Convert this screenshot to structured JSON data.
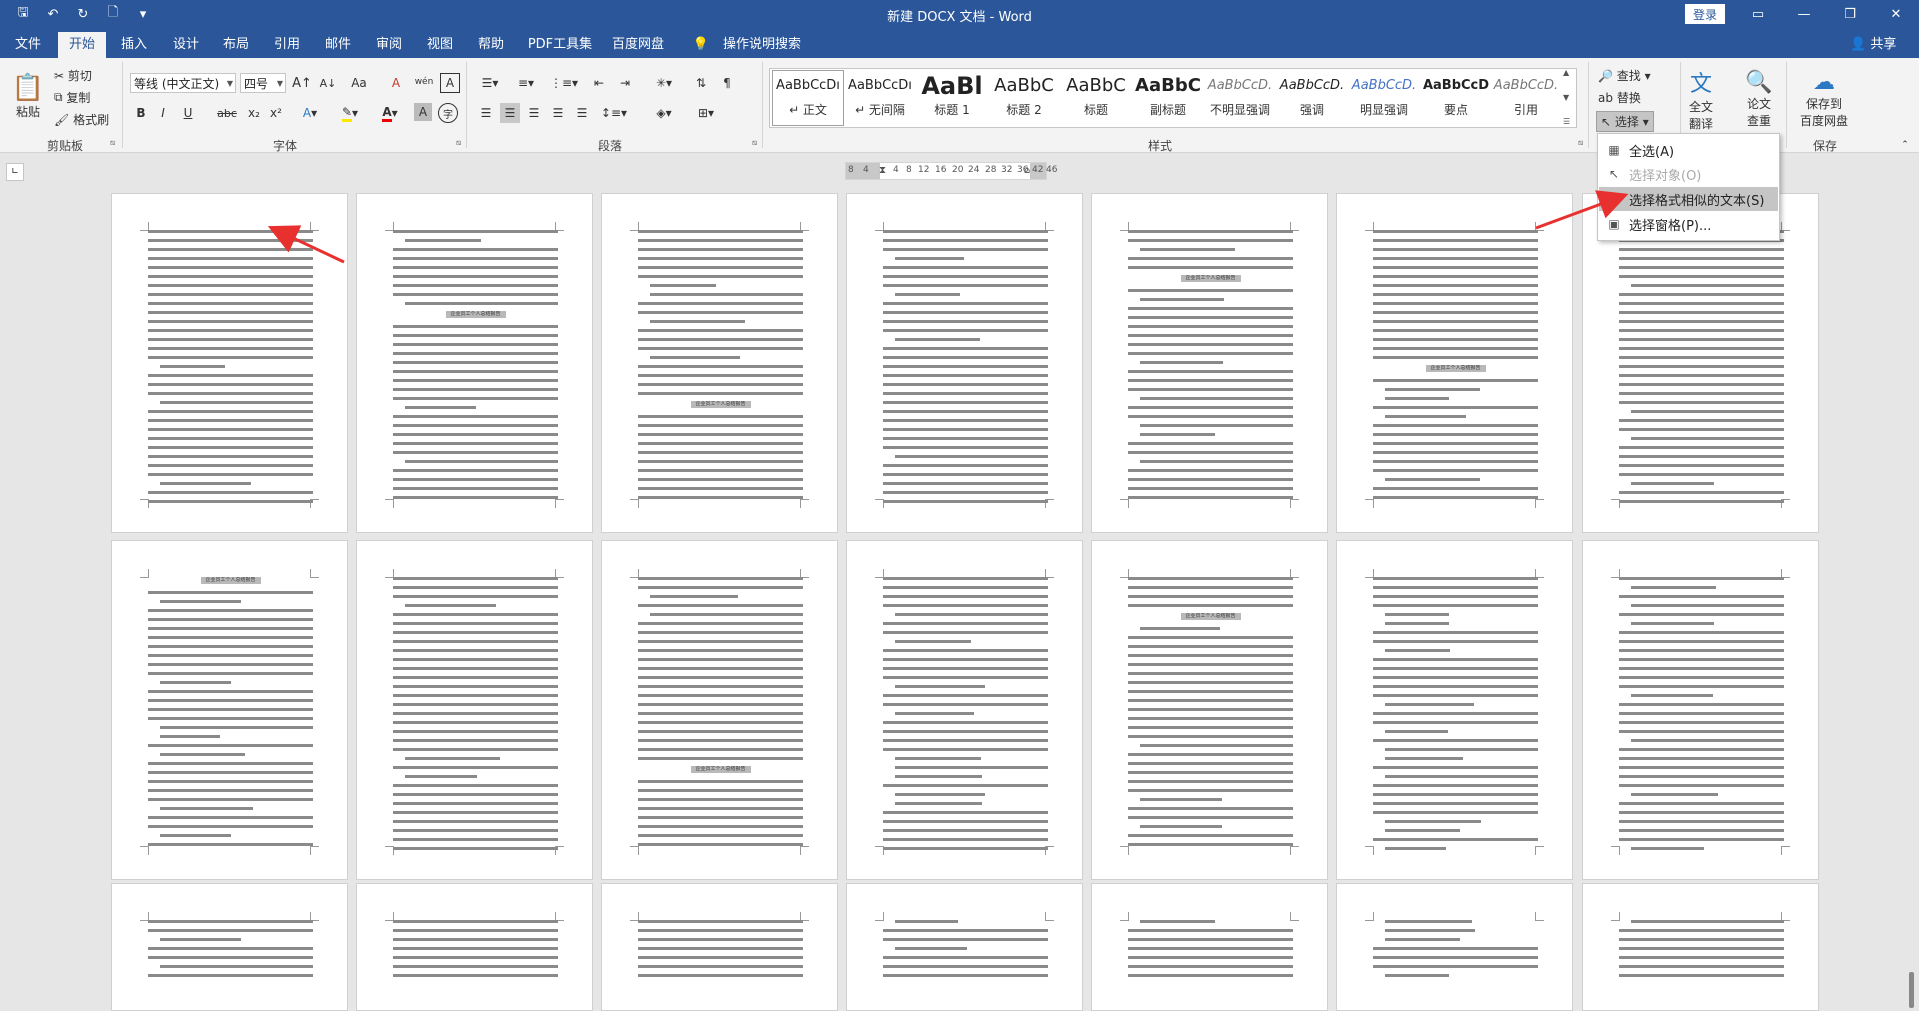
{
  "window": {
    "title": "新建 DOCX 文档 - Word",
    "login_label": "登录"
  },
  "qat": {
    "save": "🖫",
    "undo": "↶",
    "redo": "↻",
    "preview": "🗋",
    "more": "▾"
  },
  "tabs": [
    "文件",
    "开始",
    "插入",
    "设计",
    "布局",
    "引用",
    "邮件",
    "审阅",
    "视图",
    "帮助",
    "PDF工具集",
    "百度网盘",
    "操作说明搜索"
  ],
  "share_label": "共享",
  "clipboard": {
    "paste": "粘贴",
    "cut": "剪切",
    "copy": "复制",
    "format_painter": "格式刷",
    "group": "剪贴板"
  },
  "font": {
    "name": "等线 (中文正文)",
    "size": "四号",
    "group": "字体",
    "btn_bold": "B",
    "btn_italic": "I",
    "btn_underline": "U",
    "btn_strike": "abc",
    "btn_sub": "x₂",
    "btn_sup": "x²",
    "btn_grow": "A↑",
    "btn_shrink": "A↓",
    "btn_case": "Aa",
    "btn_clear": "A",
    "btn_phonetic": "wén",
    "btn_border": "A"
  },
  "paragraph": {
    "group": "段落"
  },
  "styles": {
    "group": "样式",
    "items": [
      {
        "preview": "AaBbCcDı",
        "name": "↵ 正文"
      },
      {
        "preview": "AaBbCcDı",
        "name": "↵ 无间隔"
      },
      {
        "preview": "AaBl",
        "name": "标题 1"
      },
      {
        "preview": "AaBbC",
        "name": "标题 2"
      },
      {
        "preview": "AaBbC",
        "name": "标题"
      },
      {
        "preview": "AaBbC",
        "name": "副标题"
      },
      {
        "preview": "AaBbCcD.",
        "name": "不明显强调"
      },
      {
        "preview": "AaBbCcD.",
        "name": "强调"
      },
      {
        "preview": "AaBbCcD.",
        "name": "明显强调"
      },
      {
        "preview": "AaBbCcD",
        "name": "要点"
      },
      {
        "preview": "AaBbCcD.",
        "name": "引用"
      }
    ]
  },
  "editing": {
    "find": "查找",
    "replace": "替换",
    "select": "选择"
  },
  "translate": {
    "full": "全文",
    "full2": "翻译",
    "paper": "论文",
    "paper2": "查重",
    "save_baidu": "保存到",
    "save_baidu2": "百度网盘",
    "group": "保存"
  },
  "ruler": [
    "8",
    "4",
    "",
    "4",
    "8",
    "12",
    "16",
    "20",
    "24",
    "28",
    "32",
    "36",
    "",
    "42",
    "46"
  ],
  "select_menu": {
    "items": [
      {
        "label": "全选(A)",
        "icon": "▦",
        "state": "normal"
      },
      {
        "label": "选择对象(O)",
        "icon": "↖",
        "state": "disabled"
      },
      {
        "label": "选择格式相似的文本(S)",
        "icon": "▤",
        "state": "highlighted"
      },
      {
        "label": "选择窗格(P)...",
        "icon": "▣",
        "state": "normal"
      }
    ]
  },
  "doc": {
    "heading_text": "企业员工个人总结报告",
    "page_rows": 3,
    "page_cols": 7
  },
  "colors": {
    "brand": "#2b579a",
    "annotation_arrow": "#e8312f"
  }
}
